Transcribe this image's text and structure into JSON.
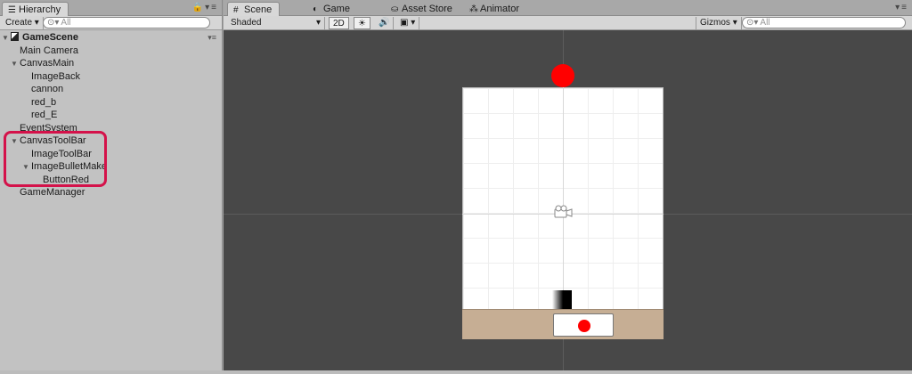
{
  "hierarchy": {
    "tab_label": "Hierarchy",
    "create_label": "Create",
    "search_placeholder": "All",
    "scene_name": "GameScene",
    "items": [
      {
        "label": "Main Camera",
        "depth": 1,
        "expanded": null
      },
      {
        "label": "CanvasMain",
        "depth": 1,
        "expanded": true
      },
      {
        "label": "ImageBack",
        "depth": 2,
        "expanded": null
      },
      {
        "label": "cannon",
        "depth": 2,
        "expanded": null
      },
      {
        "label": "red_b",
        "depth": 2,
        "expanded": null
      },
      {
        "label": "red_E",
        "depth": 2,
        "expanded": null
      },
      {
        "label": "EventSystem",
        "depth": 1,
        "expanded": null
      },
      {
        "label": "CanvasToolBar",
        "depth": 1,
        "expanded": true
      },
      {
        "label": "ImageToolBar",
        "depth": 2,
        "expanded": null
      },
      {
        "label": "ImageBulletMake",
        "depth": 2,
        "expanded": true
      },
      {
        "label": "ButtonRed",
        "depth": 3,
        "expanded": null
      },
      {
        "label": "GameManager",
        "depth": 1,
        "expanded": null
      }
    ],
    "highlight_color": "#d4124a"
  },
  "tabs": {
    "scene": "Scene",
    "game": "Game",
    "asset_store": "Asset Store",
    "animator": "Animator"
  },
  "scene_toolbar": {
    "shading_mode": "Shaded",
    "mode_2d": "2D",
    "gizmos_label": "Gizmos",
    "search_placeholder": "All"
  },
  "colors": {
    "red_ball": "#ff0000",
    "ground": "#c6ae94",
    "viewport_bg": "#484848",
    "panel_bg": "#c2c2c2"
  },
  "icons": [
    "list-icon",
    "lock-icon",
    "panel-menu-icon",
    "scene-unity-icon",
    "sun-icon",
    "audio-icon",
    "image-icon",
    "camera-gizmo-icon",
    "search-icon"
  ]
}
